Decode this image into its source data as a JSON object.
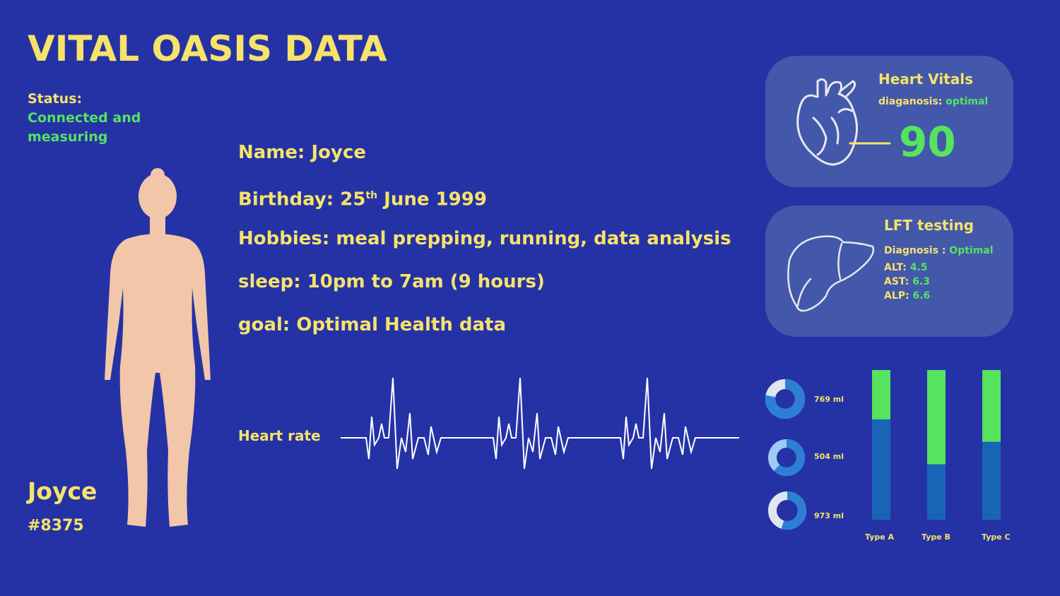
{
  "title": "VITAL OASIS DATA",
  "status": {
    "label": "Status:",
    "value": "Connected and measuring"
  },
  "patient": {
    "name": "Joyce",
    "id": "#8375"
  },
  "info": {
    "name": "Name: Joyce",
    "birthday_prefix": "Birthday: 25",
    "birthday_sup": "th",
    "birthday_suffix": " June 1999",
    "hobbies": "Hobbies: meal prepping,  running, data analysis",
    "sleep": "sleep: 10pm to 7am (9 hours)",
    "goal": "goal: Optimal Health data"
  },
  "heart_rate": {
    "label": "Heart rate"
  },
  "heart_card": {
    "title": "Heart Vitals",
    "diag_label": "diaganosis: ",
    "diag_value": "optimal",
    "value": "90"
  },
  "lft_card": {
    "title": "LFT testing",
    "diag_label": "Diagnosis : ",
    "diag_value": "Optimal",
    "rows": [
      {
        "label": "ALT: ",
        "value": "4.5"
      },
      {
        "label": "AST: ",
        "value": "6.3"
      },
      {
        "label": "ALP: ",
        "value": "6.6"
      }
    ]
  },
  "donuts": [
    {
      "label": "769 ml",
      "fraction": 0.78
    },
    {
      "label": "504 ml",
      "fraction": 0.62
    },
    {
      "label": "973 ml",
      "fraction": 0.55
    }
  ],
  "bar_chart": {
    "categories": [
      "Type A",
      "Type B",
      "Type C"
    ],
    "blue_fraction": [
      0.67,
      0.37,
      0.52
    ],
    "green_fraction": [
      0.33,
      0.63,
      0.48
    ]
  },
  "colors": {
    "background": "#2532a6",
    "yellow": "#f6e36a",
    "green": "#56e35e",
    "card": "#4358ab",
    "bar_blue": "#1a64b6",
    "skin": "#f2c6a8"
  }
}
